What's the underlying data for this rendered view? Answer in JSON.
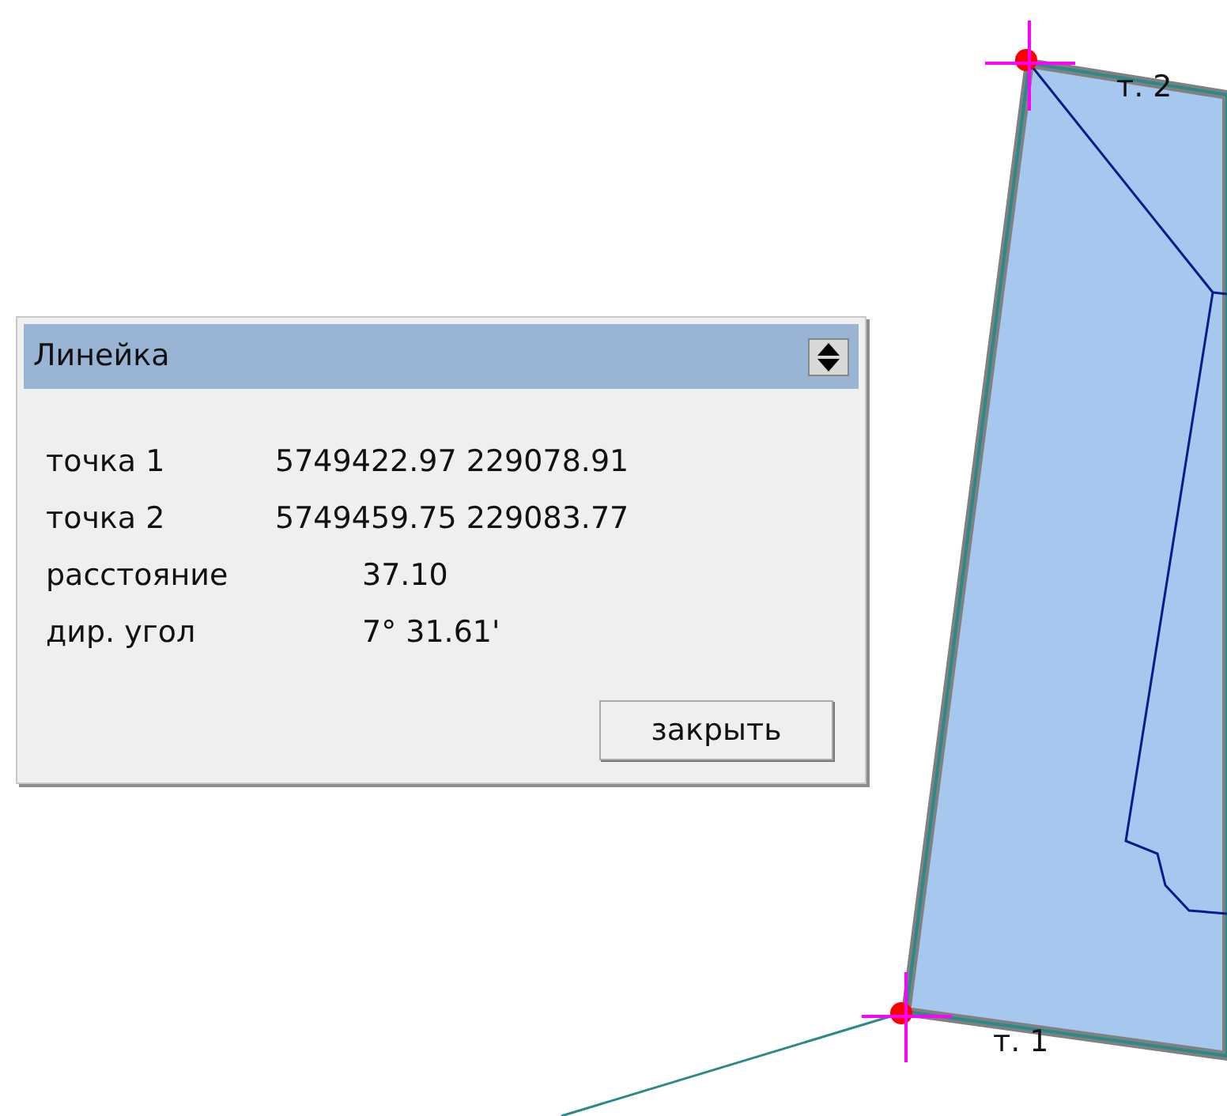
{
  "map": {
    "point_labels": [
      {
        "text": "т. 2"
      },
      {
        "text": "т. 1"
      }
    ]
  },
  "dialog": {
    "title": "Линейка",
    "rows": [
      {
        "label": "точка 1",
        "value": "5749422.97 229078.91"
      },
      {
        "label": "точка 2",
        "value": "5749459.75 229083.77"
      },
      {
        "label": "расстояние",
        "value": "37.10"
      },
      {
        "label": "дир. угол",
        "value": "7° 31.61'"
      }
    ],
    "button": "закрыть"
  }
}
